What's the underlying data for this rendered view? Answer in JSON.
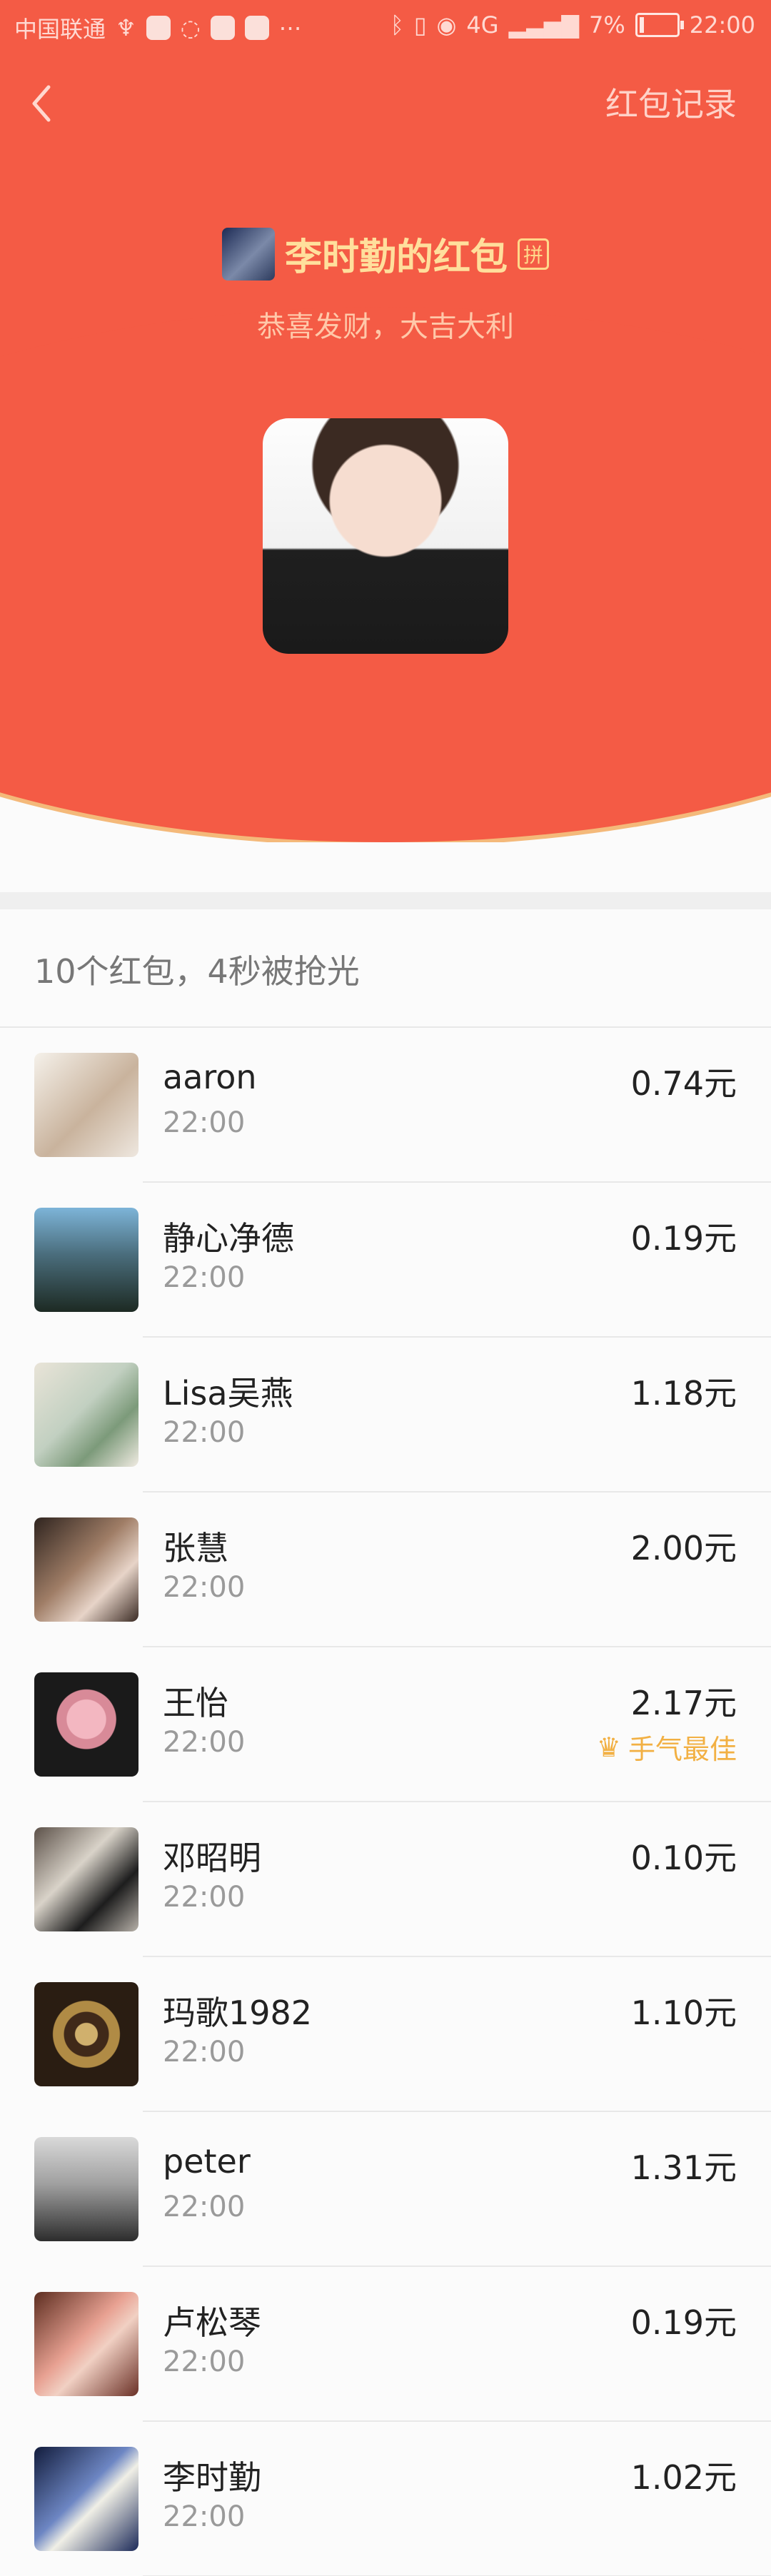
{
  "status_bar": {
    "carrier": "中国联通",
    "network": "4G",
    "battery": "7%",
    "time": "22:00"
  },
  "header": {
    "back_icon": "chevron-left-icon",
    "record_label": "红包记录"
  },
  "sender": {
    "title": "李时勤的红包",
    "pin_icon_label": "拼",
    "greeting": "恭喜发财，大吉大利"
  },
  "summary": {
    "count_text": "10个红包，4秒被抢光"
  },
  "recipients": [
    {
      "name": "aaron",
      "time": "22:00",
      "amount": "0.74元"
    },
    {
      "name": "静心净德",
      "time": "22:00",
      "amount": "0.19元"
    },
    {
      "name": "Lisa吴燕",
      "time": "22:00",
      "amount": "1.18元"
    },
    {
      "name": "张慧",
      "time": "22:00",
      "amount": "2.00元"
    },
    {
      "name": "王怡",
      "time": "22:00",
      "amount": "2.17元",
      "badge": "手气最佳"
    },
    {
      "name": "邓昭明",
      "time": "22:00",
      "amount": "0.10元"
    },
    {
      "name": "玛歌1982",
      "time": "22:00",
      "amount": "1.10元"
    },
    {
      "name": "peter",
      "time": "22:00",
      "amount": "1.31元"
    },
    {
      "name": "卢松琴",
      "time": "22:00",
      "amount": "0.19元"
    },
    {
      "name": "李时勤",
      "time": "22:00",
      "amount": "1.02元"
    }
  ],
  "colors": {
    "accent": "#f45b45",
    "gold": "#ffdf9c",
    "badge": "#f2b043"
  }
}
